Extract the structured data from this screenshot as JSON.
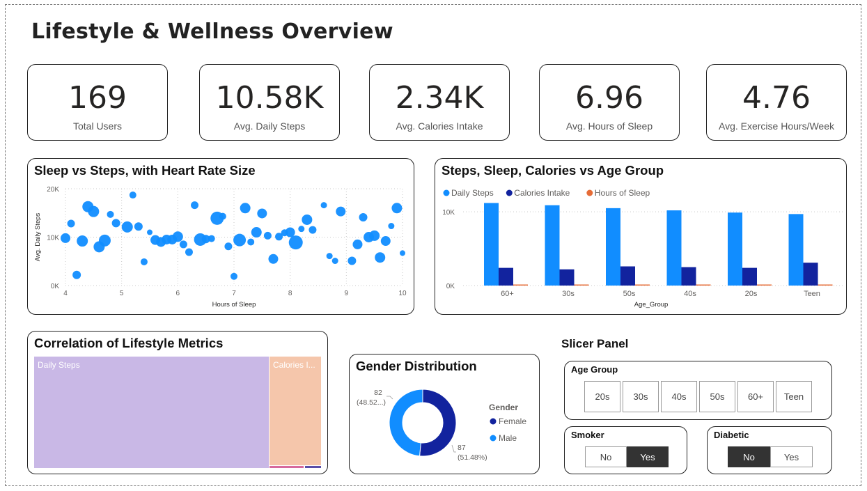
{
  "page": {
    "title": "Lifestyle & Wellness Overview"
  },
  "kpis": [
    {
      "value": "169",
      "label": "Total Users"
    },
    {
      "value": "10.58K",
      "label": "Avg. Daily Steps"
    },
    {
      "value": "2.34K",
      "label": "Avg. Calories Intake"
    },
    {
      "value": "6.96",
      "label": "Avg. Hours of Sleep"
    },
    {
      "value": "4.76",
      "label": "Avg. Exercise Hours/Week"
    }
  ],
  "colors": {
    "daily_steps": "#118DFF",
    "calories": "#12239E",
    "sleep": "#E66C37",
    "treemap_steps": "#C9B8E6",
    "treemap_cal": "#F5C6AB"
  },
  "chart_data": [
    {
      "type": "scatter",
      "title": "Sleep vs Steps, with Heart Rate Size",
      "xlabel": "Hours of Sleep",
      "ylabel": "Avg. Daily Steps",
      "xlim": [
        4,
        10
      ],
      "ylim": [
        0,
        20000
      ],
      "xticks": [
        "4",
        "5",
        "6",
        "7",
        "8",
        "9",
        "10"
      ],
      "yticks": [
        "0K",
        "10K",
        "20K"
      ],
      "grid": true,
      "points": [
        {
          "x": 4.0,
          "y": 9800,
          "s": 7
        },
        {
          "x": 4.1,
          "y": 12800,
          "s": 5.5
        },
        {
          "x": 4.2,
          "y": 2200,
          "s": 6
        },
        {
          "x": 4.3,
          "y": 9200,
          "s": 8
        },
        {
          "x": 4.4,
          "y": 16300,
          "s": 8
        },
        {
          "x": 4.5,
          "y": 15300,
          "s": 8
        },
        {
          "x": 4.6,
          "y": 8000,
          "s": 8
        },
        {
          "x": 4.7,
          "y": 9300,
          "s": 8.5
        },
        {
          "x": 4.8,
          "y": 14700,
          "s": 5
        },
        {
          "x": 4.9,
          "y": 12900,
          "s": 6
        },
        {
          "x": 5.1,
          "y": 12100,
          "s": 8
        },
        {
          "x": 5.2,
          "y": 18700,
          "s": 5
        },
        {
          "x": 5.3,
          "y": 12200,
          "s": 6
        },
        {
          "x": 5.4,
          "y": 4900,
          "s": 5
        },
        {
          "x": 5.5,
          "y": 11000,
          "s": 4
        },
        {
          "x": 5.6,
          "y": 9400,
          "s": 7
        },
        {
          "x": 5.7,
          "y": 9000,
          "s": 7
        },
        {
          "x": 5.8,
          "y": 9500,
          "s": 7
        },
        {
          "x": 5.9,
          "y": 9500,
          "s": 7
        },
        {
          "x": 6.0,
          "y": 10100,
          "s": 7.5
        },
        {
          "x": 6.1,
          "y": 8500,
          "s": 5.5
        },
        {
          "x": 6.2,
          "y": 6900,
          "s": 5.5
        },
        {
          "x": 6.3,
          "y": 16600,
          "s": 5.5
        },
        {
          "x": 6.4,
          "y": 9500,
          "s": 9
        },
        {
          "x": 6.5,
          "y": 9600,
          "s": 6
        },
        {
          "x": 6.6,
          "y": 9700,
          "s": 5
        },
        {
          "x": 6.7,
          "y": 13900,
          "s": 9.5
        },
        {
          "x": 6.8,
          "y": 14300,
          "s": 5
        },
        {
          "x": 6.9,
          "y": 8100,
          "s": 5.5
        },
        {
          "x": 7.0,
          "y": 1900,
          "s": 5
        },
        {
          "x": 7.1,
          "y": 9400,
          "s": 9
        },
        {
          "x": 7.2,
          "y": 16000,
          "s": 7.5
        },
        {
          "x": 7.3,
          "y": 9000,
          "s": 5
        },
        {
          "x": 7.4,
          "y": 11000,
          "s": 7.5
        },
        {
          "x": 7.5,
          "y": 14900,
          "s": 7
        },
        {
          "x": 7.6,
          "y": 10300,
          "s": 5.5
        },
        {
          "x": 7.7,
          "y": 5500,
          "s": 7
        },
        {
          "x": 7.8,
          "y": 10100,
          "s": 5.5
        },
        {
          "x": 7.9,
          "y": 10900,
          "s": 5
        },
        {
          "x": 8.0,
          "y": 11000,
          "s": 7
        },
        {
          "x": 8.1,
          "y": 8900,
          "s": 10
        },
        {
          "x": 8.2,
          "y": 11700,
          "s": 4.5
        },
        {
          "x": 8.3,
          "y": 13600,
          "s": 7.5
        },
        {
          "x": 8.4,
          "y": 11500,
          "s": 5.5
        },
        {
          "x": 8.6,
          "y": 16600,
          "s": 4.5
        },
        {
          "x": 8.7,
          "y": 6100,
          "s": 4.5
        },
        {
          "x": 8.8,
          "y": 5100,
          "s": 4.5
        },
        {
          "x": 8.9,
          "y": 15300,
          "s": 7
        },
        {
          "x": 9.1,
          "y": 5100,
          "s": 6
        },
        {
          "x": 9.2,
          "y": 8500,
          "s": 7
        },
        {
          "x": 9.3,
          "y": 14100,
          "s": 6
        },
        {
          "x": 9.4,
          "y": 10000,
          "s": 7.5
        },
        {
          "x": 9.5,
          "y": 10300,
          "s": 7.5
        },
        {
          "x": 9.6,
          "y": 5800,
          "s": 7.5
        },
        {
          "x": 9.7,
          "y": 9200,
          "s": 7
        },
        {
          "x": 9.8,
          "y": 12300,
          "s": 4.5
        },
        {
          "x": 9.9,
          "y": 16000,
          "s": 7.5
        },
        {
          "x": 10.0,
          "y": 6700,
          "s": 4
        }
      ]
    },
    {
      "type": "bar",
      "title": "Steps, Sleep, Calories vs Age Group",
      "xlabel": "Age_Group",
      "ylabel": "",
      "ylim": [
        0,
        12000
      ],
      "yticks": [
        "0K",
        "10K"
      ],
      "legend_position": "top-left",
      "categories": [
        "60+",
        "30s",
        "50s",
        "40s",
        "20s",
        "Teen"
      ],
      "series": [
        {
          "name": "Daily Steps",
          "values": [
            11200,
            10900,
            10500,
            10200,
            9900,
            9700
          ]
        },
        {
          "name": "Calories Intake",
          "values": [
            2400,
            2200,
            2600,
            2500,
            2400,
            3100
          ]
        },
        {
          "name": "Hours of Sleep",
          "values": [
            7,
            7,
            7,
            7,
            7,
            7
          ]
        }
      ]
    },
    {
      "type": "treemap",
      "title": "Correlation of Lifestyle Metrics",
      "items": [
        {
          "label": "Daily Steps",
          "value": 10580
        },
        {
          "label": "Calories I...",
          "value": 2340
        },
        {
          "label": "",
          "value": 7
        },
        {
          "label": "",
          "value": 5
        }
      ]
    },
    {
      "type": "donut",
      "title": "Gender Distribution",
      "legend_title": "Gender",
      "legend_position": "right",
      "slices": [
        {
          "name": "Female",
          "value": 87,
          "label": "87",
          "pct": "(51.48%)"
        },
        {
          "name": "Male",
          "value": 82,
          "label": "82",
          "pct": "(48.52...)"
        }
      ]
    }
  ],
  "slicers": {
    "panel_title": "Slicer Panel",
    "age_group": {
      "title": "Age Group",
      "options": [
        "20s",
        "30s",
        "40s",
        "50s",
        "60+",
        "Teen"
      ],
      "selected": []
    },
    "smoker": {
      "title": "Smoker",
      "options": [
        "No",
        "Yes"
      ],
      "selected": "Yes"
    },
    "diabetic": {
      "title": "Diabetic",
      "options": [
        "No",
        "Yes"
      ],
      "selected": "No"
    }
  }
}
